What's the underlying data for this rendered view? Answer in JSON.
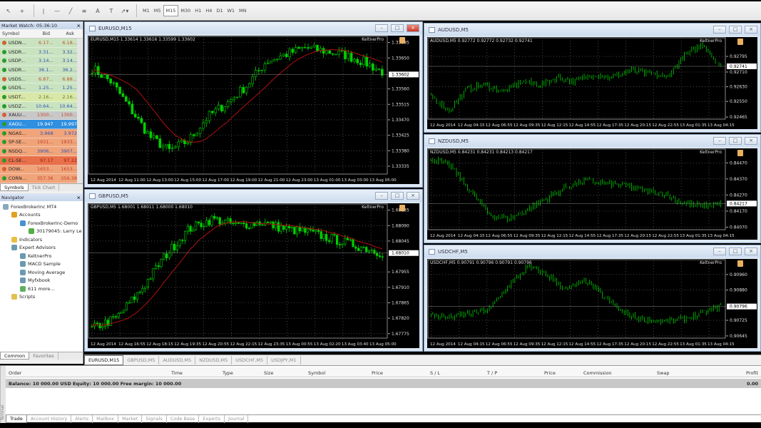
{
  "toolbar": {
    "tools": [
      "cursor-icon",
      "crosshair-icon",
      "vertical-line-icon",
      "horizontal-line-icon",
      "trendline-icon",
      "fibonacci-icon",
      "text-icon",
      "label-icon",
      "arrows-icon"
    ],
    "text_glyph": "A",
    "label_glyph": "T",
    "periods": [
      "M1",
      "M5",
      "M15",
      "M30",
      "H1",
      "H4",
      "D1",
      "W1",
      "MN"
    ],
    "active_period": "M15"
  },
  "market_watch": {
    "title": "Market Watch: 05:36:10",
    "close": "×",
    "columns": [
      "Symbol",
      "Bid",
      "Ask"
    ],
    "rows": [
      {
        "symbol": "USDN...",
        "bid": "6.17...",
        "ask": "6.18...",
        "dir": "down",
        "bg": "#c9e3c0",
        "color": "#c0502a"
      },
      {
        "symbol": "USDR...",
        "bid": "3.31...",
        "ask": "3.32...",
        "dir": "up",
        "bg": "#c9e3c0",
        "color": "#3050b0"
      },
      {
        "symbol": "USDP...",
        "bid": "3.14...",
        "ask": "3.14...",
        "dir": "up",
        "bg": "#c9e3c0",
        "color": "#3050b0"
      },
      {
        "symbol": "USDR...",
        "bid": "36.1...",
        "ask": "36.2...",
        "dir": "up",
        "bg": "#c9e3c0",
        "color": "#3050b0"
      },
      {
        "symbol": "USDS...",
        "bid": "6.87...",
        "ask": "6.88...",
        "dir": "down",
        "bg": "#c9e3c0",
        "color": "#c0502a"
      },
      {
        "symbol": "USDS...",
        "bid": "1.25...",
        "ask": "1.25...",
        "dir": "up",
        "bg": "#c9e3c0",
        "color": "#3050b0"
      },
      {
        "symbol": "USDT...",
        "bid": "2.16...",
        "ask": "2.16...",
        "dir": "up",
        "bg": "#d9e8a8",
        "color": "#6a7a20"
      },
      {
        "symbol": "USDZ...",
        "bid": "10.64...",
        "ask": "10.64...",
        "dir": "up",
        "bg": "#c9e3c0",
        "color": "#3050b0"
      },
      {
        "symbol": "XAUU...",
        "bid": "1300...",
        "ask": "1300...",
        "dir": "down",
        "bg": "#c8c8c8",
        "color": "#c0502a"
      },
      {
        "symbol": "XAGU...",
        "bid": "19.947",
        "ask": "19.997",
        "dir": "up",
        "bg": "#2f8fe0",
        "color": "#ffffff"
      },
      {
        "symbol": "NGAS...",
        "bid": "3.968",
        "ask": "3.972",
        "dir": "up",
        "bg": "#f0a47a",
        "color": "#3050b0"
      },
      {
        "symbol": "SP-SE...",
        "bid": "1931...",
        "ask": "1933...",
        "dir": "up",
        "bg": "#f0a47a",
        "color": "#c0402a"
      },
      {
        "symbol": "NSDQ...",
        "bid": "3906...",
        "ask": "3907...",
        "dir": "up",
        "bg": "#f0a47a",
        "color": "#3050b0"
      },
      {
        "symbol": "CL-SE...",
        "bid": "97.17",
        "ask": "97.22",
        "dir": "up",
        "bg": "#e8704a",
        "color": "#a02010"
      },
      {
        "symbol": "DOW...",
        "bid": "1653...",
        "ask": "1653...",
        "dir": "down",
        "bg": "#f0a47a",
        "color": "#c0402a"
      },
      {
        "symbol": "CORN...",
        "bid": "357.36",
        "ask": "356.38",
        "dir": "up",
        "bg": "#f0a47a",
        "color": "#c0402a"
      }
    ],
    "tabs": [
      "Symbols",
      "Tick Chart"
    ]
  },
  "navigator": {
    "title": "Navigator",
    "close": "×",
    "items": [
      {
        "label": "ForexBrokerInc MT4",
        "level": 0,
        "icon": "terminal-icon",
        "color": "#8ab"
      },
      {
        "label": "Accounts",
        "level": 1,
        "icon": "accounts-icon",
        "color": "#e0a020"
      },
      {
        "label": "ForexBrokerInc-Demo",
        "level": 2,
        "icon": "server-icon",
        "color": "#4a90d0"
      },
      {
        "label": "30179045: Larry Le",
        "level": 3,
        "icon": "user-icon",
        "color": "#50b040"
      },
      {
        "label": "Indicators",
        "level": 1,
        "icon": "indicators-icon",
        "color": "#e8c040"
      },
      {
        "label": "Expert Advisors",
        "level": 1,
        "icon": "expert-advisors-icon",
        "color": "#6a9ab0"
      },
      {
        "label": "KeltnerPro",
        "level": 2,
        "icon": "expert-icon",
        "color": "#6a9ab0"
      },
      {
        "label": "MACD Sample",
        "level": 2,
        "icon": "expert-icon",
        "color": "#6a9ab0"
      },
      {
        "label": "Moving Average",
        "level": 2,
        "icon": "expert-icon",
        "color": "#6a9ab0"
      },
      {
        "label": "Myfxbook",
        "level": 2,
        "icon": "expert-icon",
        "color": "#6a9ab0"
      },
      {
        "label": "611 more...",
        "level": 2,
        "icon": "more-icon",
        "color": "#60b060"
      },
      {
        "label": "Scripts",
        "level": 1,
        "icon": "scripts-icon",
        "color": "#e0c050"
      }
    ],
    "tabs": [
      "Common",
      "Favorites"
    ]
  },
  "colors": {
    "bull": "#00d000",
    "ma": "#b01010",
    "grid": "#707070",
    "axis_text": "#e0e0e0"
  },
  "charts": [
    {
      "id": "eurusd",
      "title": "EURUSD,M15",
      "header": "EURUSD,M15  1.33614 1.33616 1.33599 1.33602",
      "indicator": "KeltnerPro",
      "ylim": [
        1.3331,
        1.33715
      ],
      "yticks": [
        "1.33695",
        "1.33650",
        "1.33560",
        "1.33515",
        "1.33470",
        "1.33425",
        "1.33380",
        "1.33335"
      ],
      "current": "1.33602",
      "xlabels": [
        "12 Aug 2014",
        "12 Aug 11:00",
        "12 Aug 13:00",
        "12 Aug 15:00",
        "12 Aug 17:00",
        "12 Aug 19:00",
        "12 Aug 21:00",
        "12 Aug 23:00",
        "13 Aug 01:00",
        "13 Aug 03:00",
        "13 Aug 05:00"
      ],
      "bars": 95,
      "style": "candle",
      "anchors": [
        1.3362,
        1.3358,
        1.335,
        1.3342,
        1.3338,
        1.3341,
        1.3348,
        1.3352,
        1.3357,
        1.3364,
        1.3366,
        1.3368,
        1.3367,
        1.3366,
        1.3364,
        1.3361
      ]
    },
    {
      "id": "gbpusd",
      "title": "GBPUSD,M5",
      "header": "GBPUSD,M5  1.68001 1.68011 1.68000 1.68010",
      "indicator": "KeltnerPro",
      "ylim": [
        1.6776,
        1.68155
      ],
      "yticks": [
        "1.68135",
        "1.68090",
        "1.68045",
        "1.67955",
        "1.67910",
        "1.67865",
        "1.67820",
        "1.67775"
      ],
      "current": "1.68010",
      "xlabels": [
        "12 Aug 2014",
        "12 Aug 16:55",
        "12 Aug 18:15",
        "12 Aug 19:35",
        "12 Aug 20:55",
        "12 Aug 22:15",
        "12 Aug 23:35",
        "13 Aug 00:55",
        "13 Aug 02:20",
        "13 Aug 03:40",
        "13 Aug 05:00"
      ],
      "bars": 110,
      "style": "candle",
      "anchors": [
        1.6779,
        1.6782,
        1.679,
        1.68,
        1.6808,
        1.6811,
        1.6809,
        1.681,
        1.6808,
        1.6807,
        1.6805,
        1.6803,
        1.6801
      ]
    },
    {
      "id": "audusd",
      "title": "AUDUSD,M5",
      "header": "AUDUSD,M5  0.92772 0.92772 0.92732 0.92741",
      "indicator": "KeltnerPro",
      "ylim": [
        0.9245,
        0.929
      ],
      "yticks": [
        "0.92795",
        "0.92710",
        "0.92630",
        "0.92550",
        "0.92465"
      ],
      "current": "0.92741",
      "xlabels": [
        "12 Aug 2014",
        "12 Aug 04:15",
        "12 Aug 06:55",
        "12 Aug 09:35",
        "12 Aug 12:15",
        "12 Aug 14:55",
        "12 Aug 17:35",
        "12 Aug 20:15",
        "12 Aug 22:55",
        "13 Aug 01:35",
        "13 Aug 04:15"
      ],
      "bars": 160,
      "style": "bar",
      "anchors": [
        0.9258,
        0.925,
        0.9262,
        0.9264,
        0.926,
        0.9266,
        0.9264,
        0.9268,
        0.9266,
        0.927,
        0.9268,
        0.9272,
        0.927,
        0.9268,
        0.928,
        0.9286,
        0.9274
      ]
    },
    {
      "id": "nzdusd",
      "title": "NZDUSD,M5",
      "header": "NZDUSD,M5  0.84231 0.84231 0.84213 0.84217",
      "indicator": "KeltnerPro",
      "ylim": [
        0.8405,
        0.8456
      ],
      "yticks": [
        "0.84470",
        "0.84370",
        "0.84270",
        "0.84170",
        "0.84070"
      ],
      "current": "0.84217",
      "xlabels": [
        "12 Aug 2014",
        "12 Aug 04:15",
        "12 Aug 06:55",
        "12 Aug 09:35",
        "12 Aug 12:15",
        "12 Aug 14:55",
        "12 Aug 17:35",
        "12 Aug 20:15",
        "12 Aug 22:55",
        "13 Aug 01:35",
        "13 Aug 04:15"
      ],
      "bars": 160,
      "style": "bar",
      "anchors": [
        0.845,
        0.8445,
        0.843,
        0.8415,
        0.8412,
        0.8418,
        0.8425,
        0.8432,
        0.8436,
        0.8434,
        0.8433,
        0.843,
        0.8428,
        0.8422,
        0.842,
        0.8422
      ]
    },
    {
      "id": "usdchf",
      "title": "USDCHF,M5",
      "header": "USDCHF,M5  0.90791 0.90796 0.90791 0.90796",
      "indicator": "KeltnerPro",
      "ylim": [
        0.9063,
        0.9104
      ],
      "yticks": [
        "0.90960",
        "0.90880",
        "0.90725",
        "0.90645"
      ],
      "current": "0.90796",
      "xlabels": [
        "12 Aug 2014",
        "12 Aug 04:15",
        "12 Aug 06:55",
        "12 Aug 09:35",
        "12 Aug 12:15",
        "12 Aug 14:55",
        "12 Aug 17:35",
        "12 Aug 20:15",
        "12 Aug 22:55",
        "13 Aug 01:35",
        "13 Aug 04:15"
      ],
      "bars": 160,
      "style": "bar",
      "anchors": [
        0.9075,
        0.9074,
        0.9076,
        0.9078,
        0.909,
        0.91,
        0.9096,
        0.9088,
        0.9093,
        0.9084,
        0.9076,
        0.9073,
        0.9072,
        0.9073,
        0.9076,
        0.908
      ]
    }
  ],
  "chart_tabs": [
    "EURUSD,M15",
    "GBPUSD,M5",
    "AUDUSD,M5",
    "NZDUSD,M5",
    "USDCHF,M5",
    "USDJPY,M1"
  ],
  "terminal": {
    "label": "Terminal",
    "columns": [
      "Order",
      "Time",
      "Type",
      "Size",
      "Symbol",
      "Price",
      "S / L",
      "T / P",
      "Price",
      "Commission",
      "Swap",
      "Profit"
    ],
    "balance": "Balance: 10 000.00 USD  Equity: 10 000.00  Free margin: 10 000.00",
    "profit": "0.00",
    "tabs": [
      "Trade",
      "Account History",
      "Alerts",
      "Mailbox",
      "Market",
      "Signals",
      "Code Base",
      "Experts",
      "Journal"
    ]
  }
}
